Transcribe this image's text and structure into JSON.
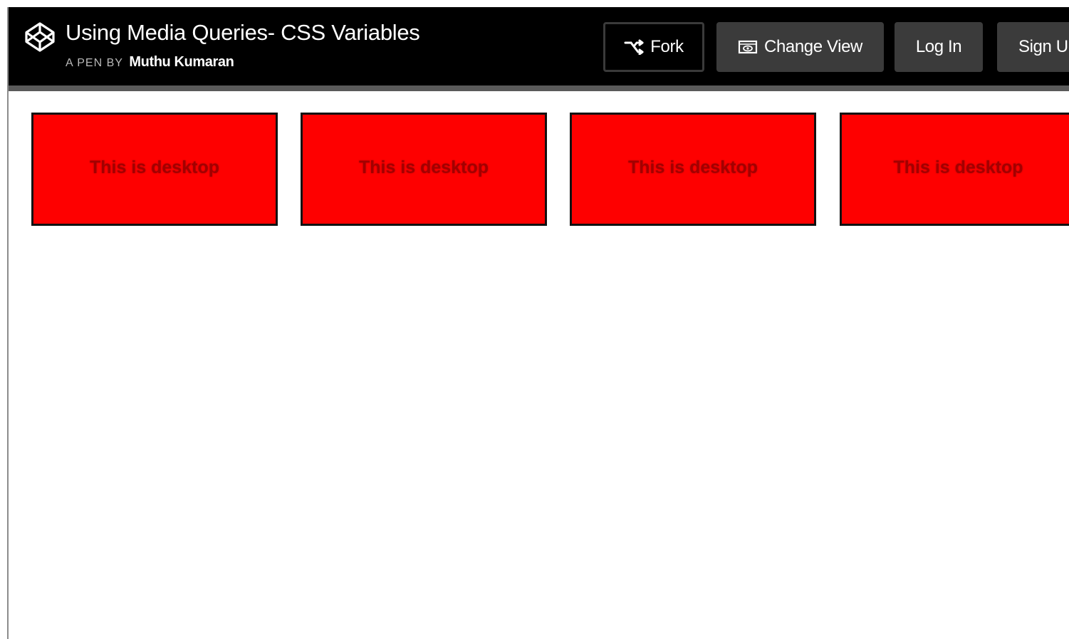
{
  "header": {
    "title": "Using Media Queries- CSS Variables",
    "byline_prefix": "A PEN BY",
    "author": "Muthu Kumaran",
    "logo_icon": "codepen-logo-icon"
  },
  "toolbar": {
    "fork_label": "Fork",
    "fork_icon": "fork-icon",
    "change_view_label": "Change View",
    "change_view_icon": "eye-icon",
    "login_label": "Log In",
    "signup_label": "Sign Up"
  },
  "preview": {
    "boxes": [
      {
        "label": "This is desktop"
      },
      {
        "label": "This is desktop"
      },
      {
        "label": "This is desktop"
      },
      {
        "label": "This is desktop"
      }
    ],
    "box_color": "#fe0000",
    "label_color": "#a20000"
  }
}
